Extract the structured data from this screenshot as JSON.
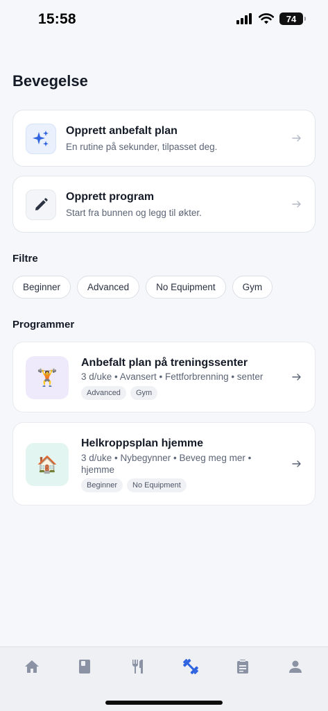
{
  "status_bar": {
    "time": "15:58",
    "battery": "74"
  },
  "page_title": "Bevegelse",
  "actions": [
    {
      "title": "Opprett anbefalt plan",
      "subtitle": "En rutine på sekunder, tilpasset deg.",
      "icon": "sparkles-icon"
    },
    {
      "title": "Opprett program",
      "subtitle": "Start fra bunnen og legg til økter.",
      "icon": "pencil-icon"
    }
  ],
  "filters": {
    "label": "Filtre",
    "chips": [
      "Beginner",
      "Advanced",
      "No Equipment",
      "Gym"
    ]
  },
  "programs": {
    "label": "Programmer",
    "items": [
      {
        "title": "Anbefalt plan på treningssenter",
        "meta": "3 d/uke • Avansert • Fettforbrenning • senter",
        "emoji": "🏋️",
        "tags": [
          "Advanced",
          "Gym"
        ]
      },
      {
        "title": "Helkroppsplan hjemme",
        "meta": "3 d/uke • Nybegynner • Beveg meg mer • hjemme",
        "emoji": "🏠",
        "tags": [
          "Beginner",
          "No Equipment"
        ]
      }
    ]
  },
  "nav": {
    "items": [
      "home-icon",
      "book-icon",
      "fork-knife-icon",
      "dumbbell-icon",
      "clipboard-icon",
      "person-icon"
    ],
    "active": "dumbbell-icon",
    "active_color": "#2f63e0",
    "inactive_color": "#8a92a3"
  }
}
